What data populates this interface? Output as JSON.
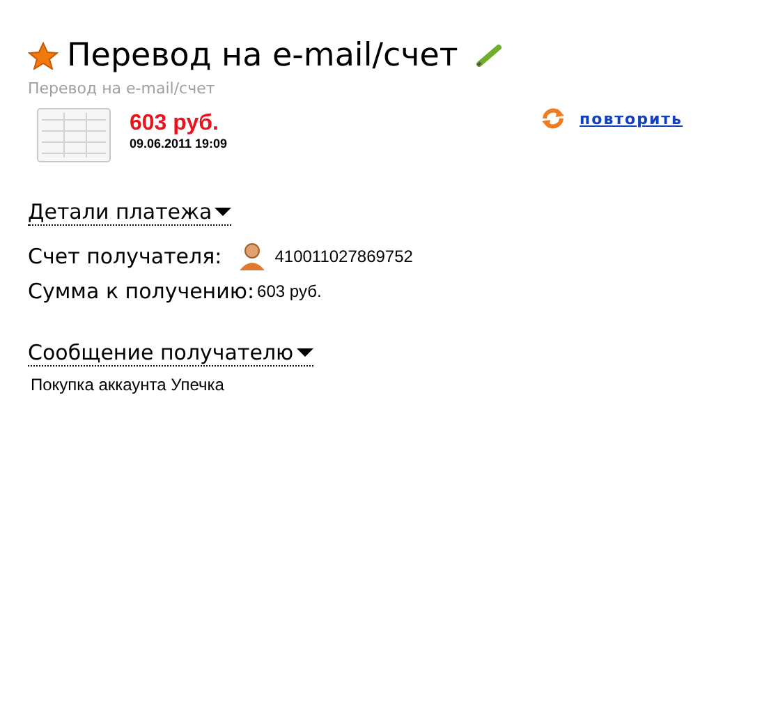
{
  "header": {
    "title": "Перевод на e-mail/счет",
    "subtitle": "Перевод на e-mail/счет"
  },
  "payment": {
    "amount": "603 руб.",
    "datetime": "09.06.2011 19:09",
    "repeat_link": "повторить"
  },
  "details": {
    "heading": "Детали платежа",
    "expanded": true,
    "fields": [
      {
        "label": "Счет получателя:",
        "value": "410011027869752",
        "kind": "account"
      },
      {
        "label": "Сумма к получению:",
        "value": "603 руб.",
        "kind": "plain"
      }
    ]
  },
  "message": {
    "heading": "Сообщение получателю",
    "expanded": true,
    "text": "Покупка аккаунта Упечка"
  }
}
